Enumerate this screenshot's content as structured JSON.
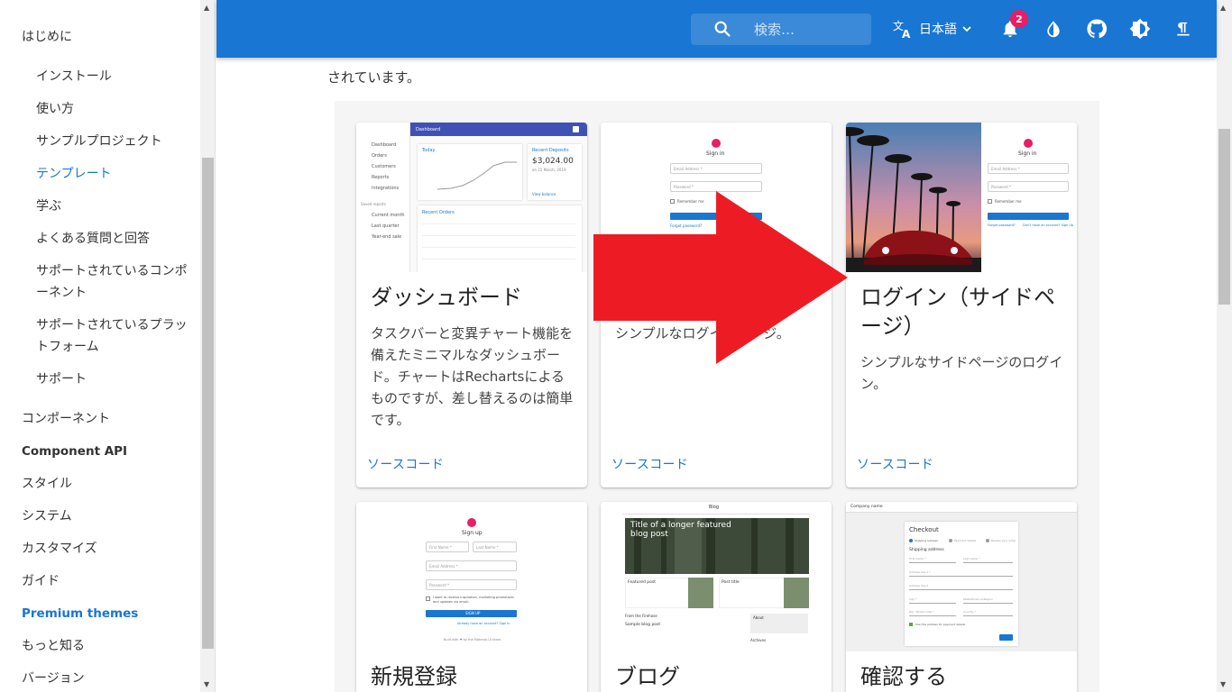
{
  "sidebar": {
    "items": [
      {
        "label": "はじめに"
      },
      {
        "label": "インストール"
      },
      {
        "label": "使い方"
      },
      {
        "label": "サンプルプロジェクト"
      },
      {
        "label": "テンプレート"
      },
      {
        "label": "学ぶ"
      },
      {
        "label": "よくある質問と回答"
      },
      {
        "label": "サポートされているコンポーネント"
      },
      {
        "label": "サポートされているプラットフォーム"
      },
      {
        "label": "サポート"
      },
      {
        "label": "コンポーネント"
      },
      {
        "label": "Component API"
      },
      {
        "label": "スタイル"
      },
      {
        "label": "システム"
      },
      {
        "label": "カスタマイズ"
      },
      {
        "label": "ガイド"
      },
      {
        "label": "Premium themes"
      },
      {
        "label": "もっと知る"
      },
      {
        "label": "バージョン"
      }
    ]
  },
  "appbar": {
    "search_placeholder": "検索…",
    "language": "日本語",
    "notification_count": "2"
  },
  "intro": {
    "line2": "されています。"
  },
  "cards": [
    {
      "title": "ダッシュボード",
      "desc": "タスクバーと変異チャート機能を備えたミニマルなダッシュボード。チャートはRechartsによるものですが、差し替えるのは簡単です。",
      "link": "ソースコード"
    },
    {
      "title": "",
      "desc": "シンプルなログインページ。",
      "link": "ソースコード"
    },
    {
      "title": "ログイン（サイドページ）",
      "desc": "シンプルなサイドページのログイン。",
      "link": "ソースコード"
    },
    {
      "title": "新規登録"
    },
    {
      "title": "ブログ"
    },
    {
      "title": "確認する"
    }
  ],
  "thumbs": {
    "dashboard": {
      "header": "Dashboard",
      "nav": [
        "Dashboard",
        "Orders",
        "Customers",
        "Reports",
        "Integrations"
      ],
      "saved": "Saved reports",
      "reports": [
        "Current month",
        "Last quarter",
        "Year-end sale"
      ],
      "today": "Today",
      "deposits": "Recent Deposits",
      "amount": "$3,024.00",
      "date": "on 15 March, 2019",
      "orders": "Recent Orders",
      "view_balance": "View balance"
    },
    "signin": {
      "title": "Sign in",
      "email": "Email Address *",
      "password": "Password *",
      "remember": "Remember me",
      "forgot": "Forgot password?",
      "signup_link": "Don't have an account? Sign Up"
    },
    "signup": {
      "title": "Sign up",
      "first": "First Name *",
      "last": "Last Name *",
      "email": "Email Address *",
      "password": "Password *",
      "promo": "I want to receive inspiration, marketing promotions and updates via email.",
      "button": "SIGN UP",
      "already": "Already have an account? Sign in",
      "footer": "Built with ❤ by the Material-UI team."
    },
    "blog": {
      "brand": "Blog",
      "headline": "Title of a longer featured blog post",
      "featured": "Featured post",
      "post_title": "Post title",
      "from": "From the Firehose",
      "sample": "Sample blog post",
      "about": "About",
      "archives": "Archives"
    },
    "checkout": {
      "company": "Company name",
      "title": "Checkout",
      "steps": [
        "Shipping address",
        "Payment details",
        "Review your order"
      ],
      "section": "Shipping address",
      "fields": [
        "First name *",
        "Last name *",
        "Address line 1 *",
        "Address line 2",
        "City *",
        "State/Province/Region",
        "Zip / Postal code *",
        "Country *"
      ],
      "save": "Use this address for payment details"
    }
  },
  "colors": {
    "primary": "#1976d2",
    "accent": "#e91e63",
    "arrow": "#ed1c24"
  }
}
